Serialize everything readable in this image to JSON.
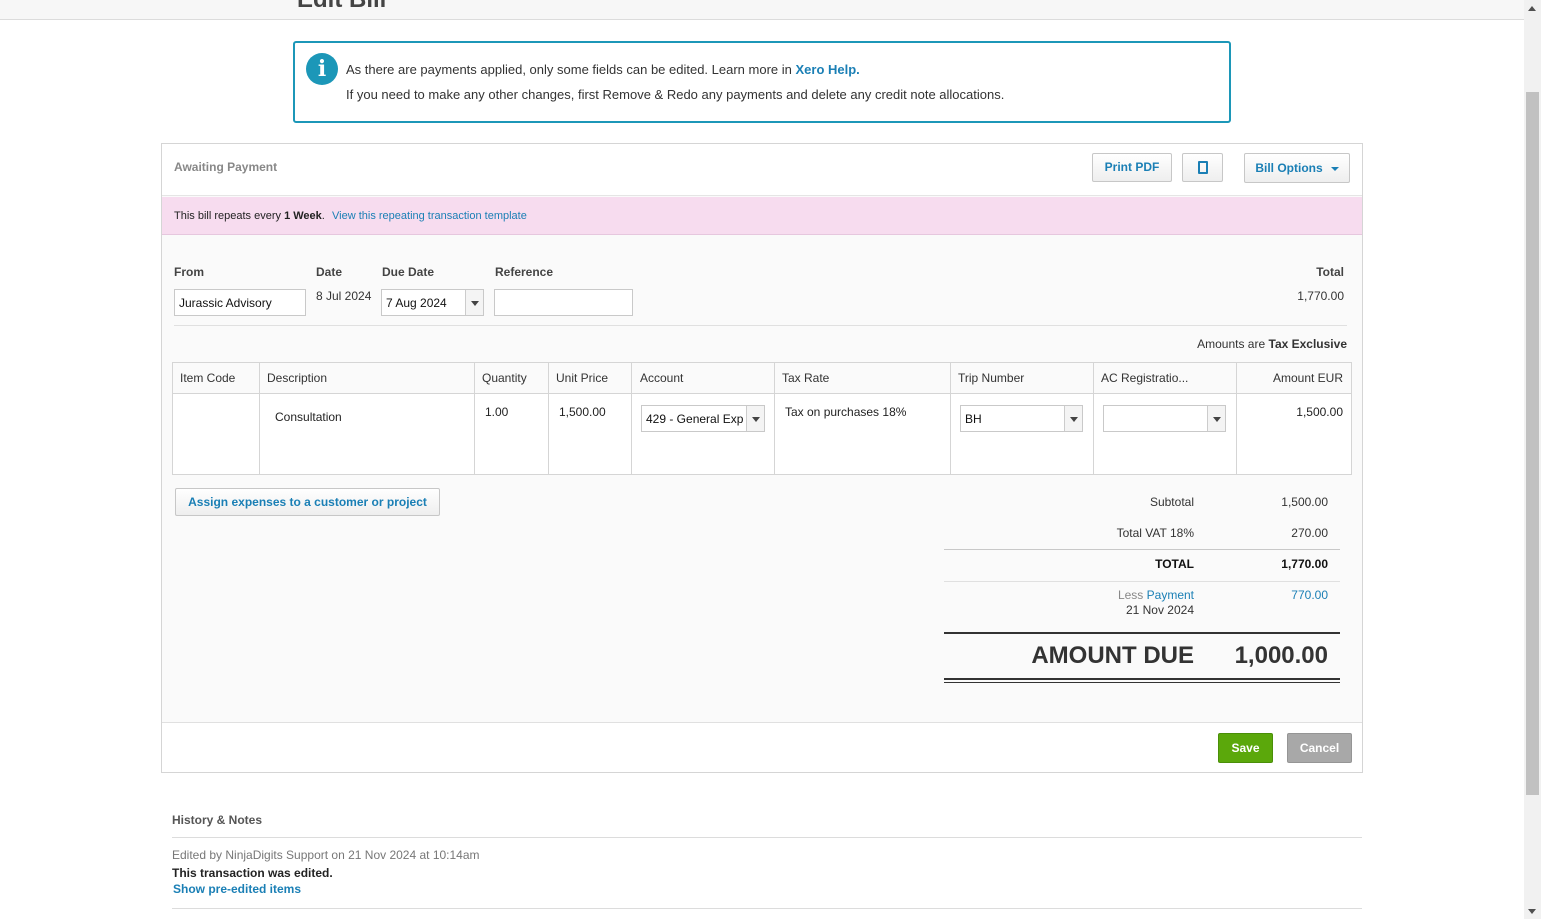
{
  "page": {
    "title": "Edit Bill"
  },
  "info": {
    "line1": "As there are payments applied, only some fields can be edited. Learn more in",
    "help_link": "Xero Help.",
    "line2": "If you need to make any other changes, first Remove & Redo any payments and delete any credit note allocations."
  },
  "header": {
    "status": "Awaiting Payment",
    "print_label": "Print PDF",
    "options_label": "Bill Options"
  },
  "repeat": {
    "prefix": "This bill repeats every",
    "period": "1 Week",
    "suffix": ".",
    "link": "View this repeating transaction template"
  },
  "fields": {
    "from_label": "From",
    "from_value": "Jurassic Advisory",
    "date_label": "Date",
    "date_value": "8 Jul 2024",
    "due_label": "Due Date",
    "due_value": "7 Aug 2024",
    "ref_label": "Reference",
    "ref_value": "",
    "total_label": "Total",
    "total_value": "1,770.00"
  },
  "tax_mode": {
    "prefix": "Amounts are",
    "value": "Tax Exclusive"
  },
  "table": {
    "headers": [
      "Item Code",
      "Description",
      "Quantity",
      "Unit Price",
      "Account",
      "Tax Rate",
      "Trip Number",
      "AC Registratio...",
      "Amount EUR"
    ],
    "rows": [
      {
        "item_code": "",
        "description": "Consultation",
        "quantity": "1.00",
        "unit_price": "1,500.00",
        "account": "429 - General Exp",
        "tax_rate": "Tax on purchases 18%",
        "trip_number": "BH",
        "ac_registration": "",
        "amount": "1,500.00"
      }
    ]
  },
  "assign_label": "Assign expenses to a customer or project",
  "totals": {
    "subtotal_label": "Subtotal",
    "subtotal_value": "1,500.00",
    "vat_label": "Total VAT 18%",
    "vat_value": "270.00",
    "total_label": "TOTAL",
    "total_value": "1,770.00",
    "less_label": "Less",
    "payment_link": "Payment",
    "payment_date": "21 Nov 2024",
    "payment_value": "770.00",
    "due_label": "AMOUNT DUE",
    "due_value": "1,000.00"
  },
  "footer": {
    "save_label": "Save",
    "cancel_label": "Cancel"
  },
  "history": {
    "title": "History & Notes",
    "meta": "Edited by NinjaDigits Support on 21 Nov 2024 at 10:14am",
    "message": "This transaction was edited.",
    "link": "Show pre-edited items"
  },
  "colors": {
    "accent": "#1a7fb5",
    "info_border": "#1c97b8",
    "save": "#5ba80b",
    "repeat_bg": "#f7dcef"
  },
  "icons": [
    "info-icon",
    "copy-icon",
    "chevron-down-icon"
  ]
}
